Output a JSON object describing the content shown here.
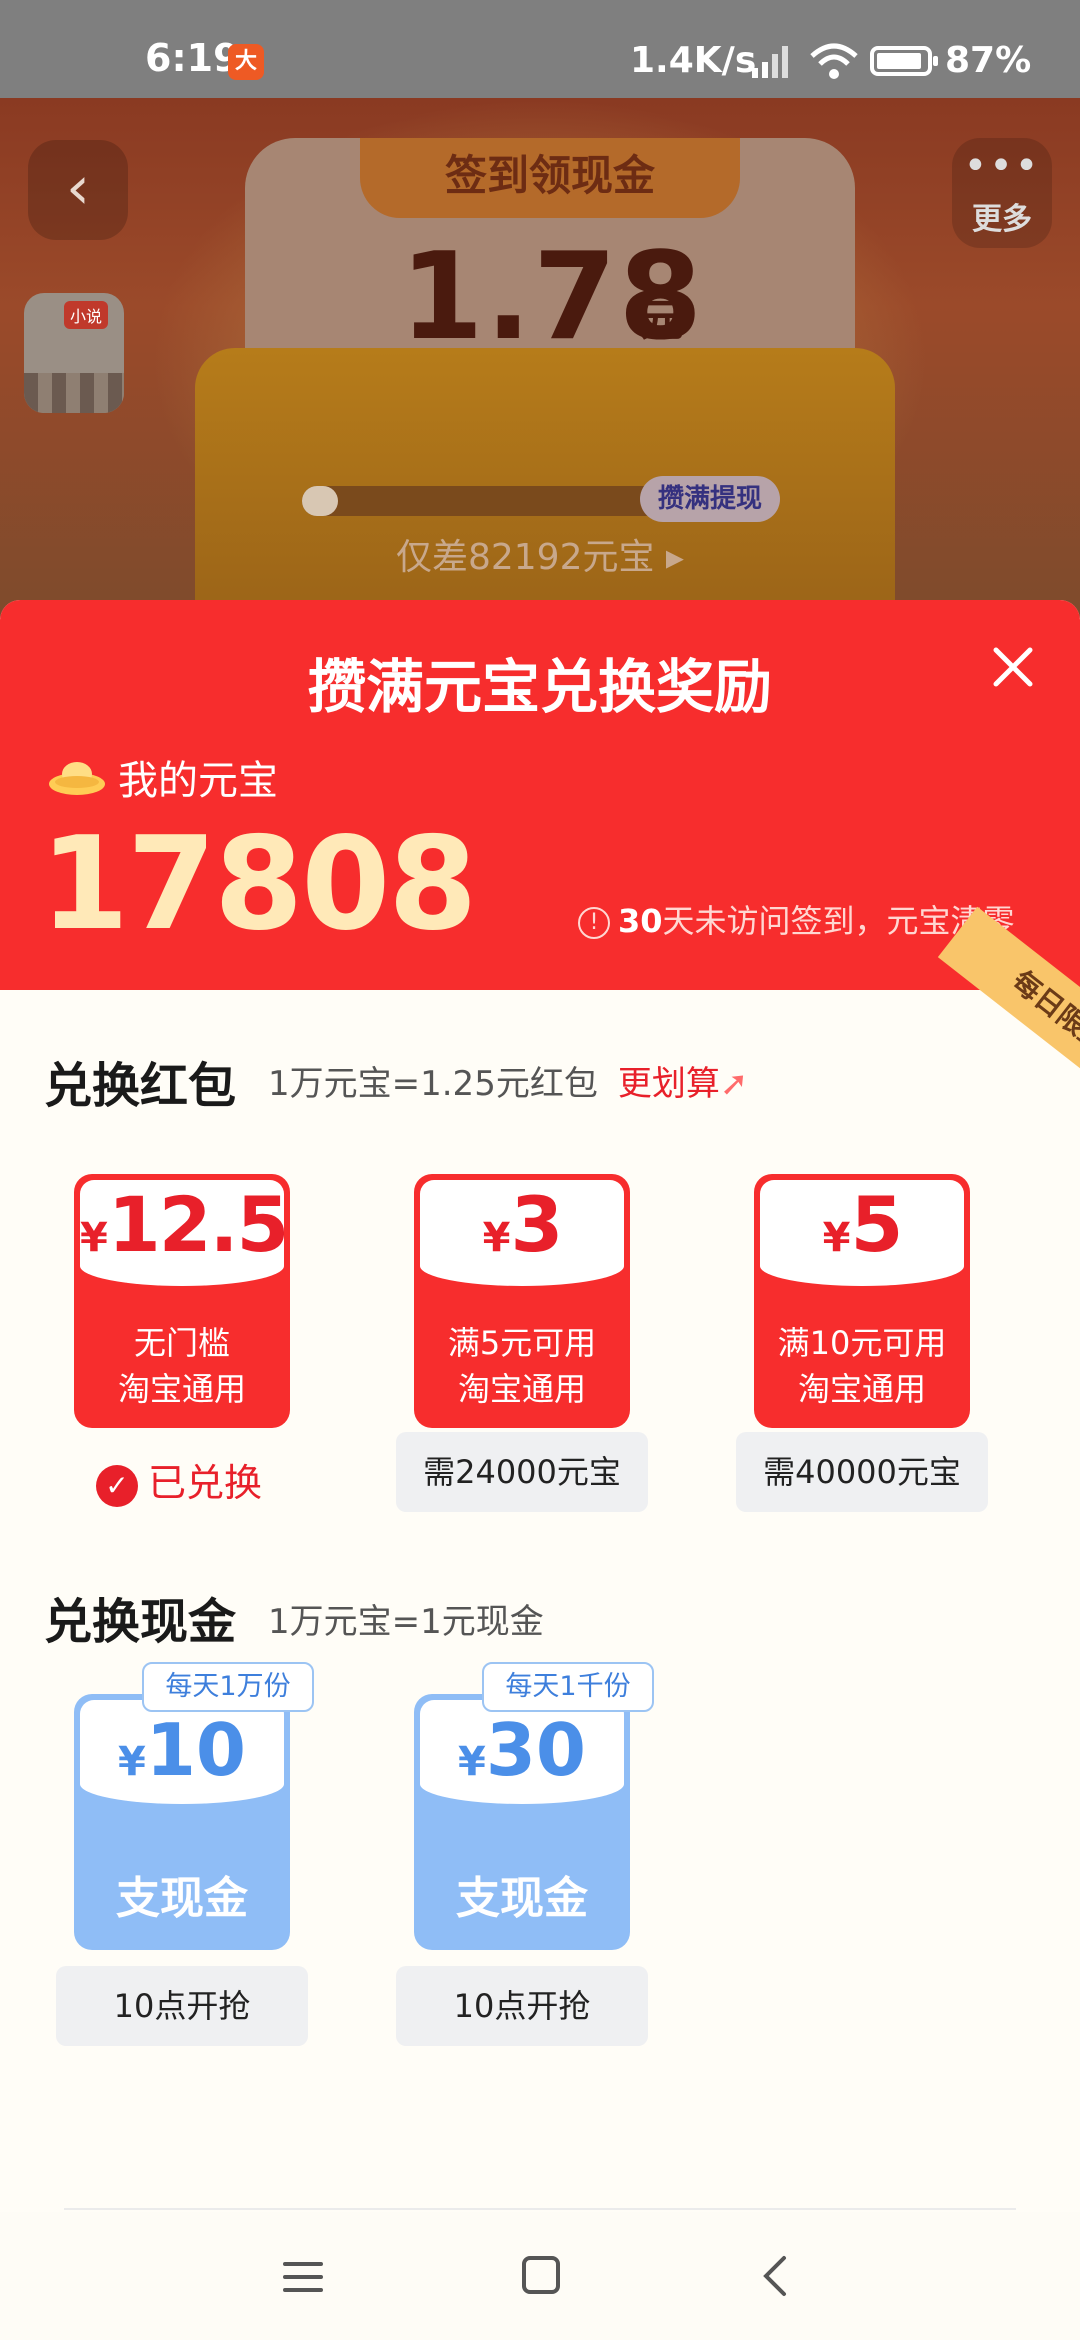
{
  "status": {
    "time": "6:19",
    "app_badge": "大",
    "net_speed": "1.4K/s",
    "battery": "87%"
  },
  "header": {
    "more_label": "更多",
    "card_title": "签到领现金",
    "amount": "1.78",
    "amount_unit": "元",
    "avatar_tag": "小说",
    "progress_fraction": 0.1,
    "progress_button": "攒满提现",
    "gap_text": "仅差82192元宝 ▸"
  },
  "modal": {
    "title": "攒满元宝兑换奖励",
    "my_label": "我的元宝",
    "balance": "17808",
    "warning_days": "30",
    "warning_text": "天未访问签到，元宝清零",
    "ribbon": "每日限量"
  },
  "redpacket": {
    "title": "兑换红包",
    "rate": "1万元宝=1.25元红包",
    "hot": "更划算",
    "coupons": [
      {
        "yen": "¥",
        "value": "12.5",
        "line1": "无门槛",
        "line2": "淘宝通用"
      },
      {
        "yen": "¥",
        "value": "3",
        "line1": "满5元可用",
        "line2": "淘宝通用"
      },
      {
        "yen": "¥",
        "value": "5",
        "line1": "满10元可用",
        "line2": "淘宝通用"
      }
    ],
    "redeemed": "已兑换",
    "req_2": "需24000元宝",
    "req_3": "需40000元宝"
  },
  "cash": {
    "title": "兑换现金",
    "rate": "1万元宝=1元现金",
    "items": [
      {
        "badge": "每天1万份",
        "yen": "¥",
        "value": "10",
        "label": "支现金",
        "button": "10点开抢"
      },
      {
        "badge": "每天1千份",
        "yen": "¥",
        "value": "30",
        "label": "支现金",
        "button": "10点开抢"
      }
    ]
  },
  "colors": {
    "modal_red": "#f72d2d",
    "cash_blue": "#8fbdf6",
    "balance_gold": "#ffe9b8"
  }
}
